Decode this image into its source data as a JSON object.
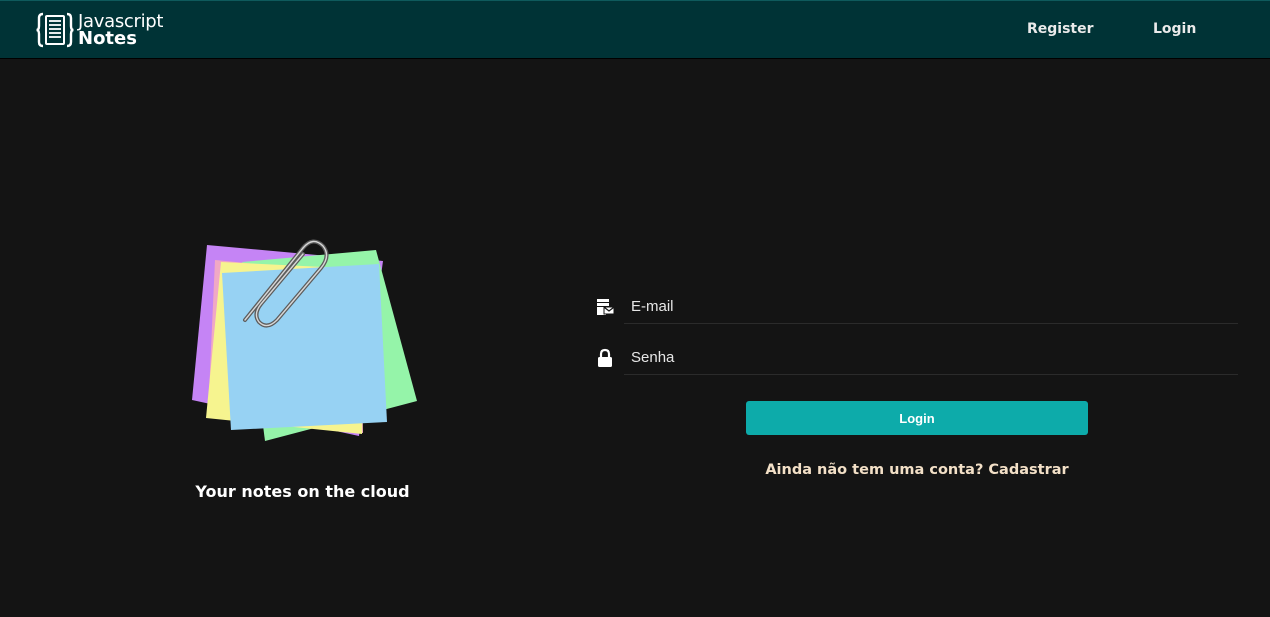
{
  "navbar": {
    "brand_line1": "Javascript",
    "brand_line2": "Notes",
    "register_label": "Register",
    "login_label": "Login",
    "background_color": "#003336"
  },
  "hero": {
    "tagline": "Your notes on the cloud",
    "illustration_icon": "sticky-notes-with-paperclip"
  },
  "login_form": {
    "email": {
      "icon": "mail-stack-icon",
      "placeholder": "E-mail",
      "value": ""
    },
    "password": {
      "icon": "lock-icon",
      "placeholder": "Senha",
      "value": ""
    },
    "submit_label": "Login",
    "signup_text": "Ainda não tem uma conta? Cadastrar",
    "button_color": "#0dabaa"
  }
}
